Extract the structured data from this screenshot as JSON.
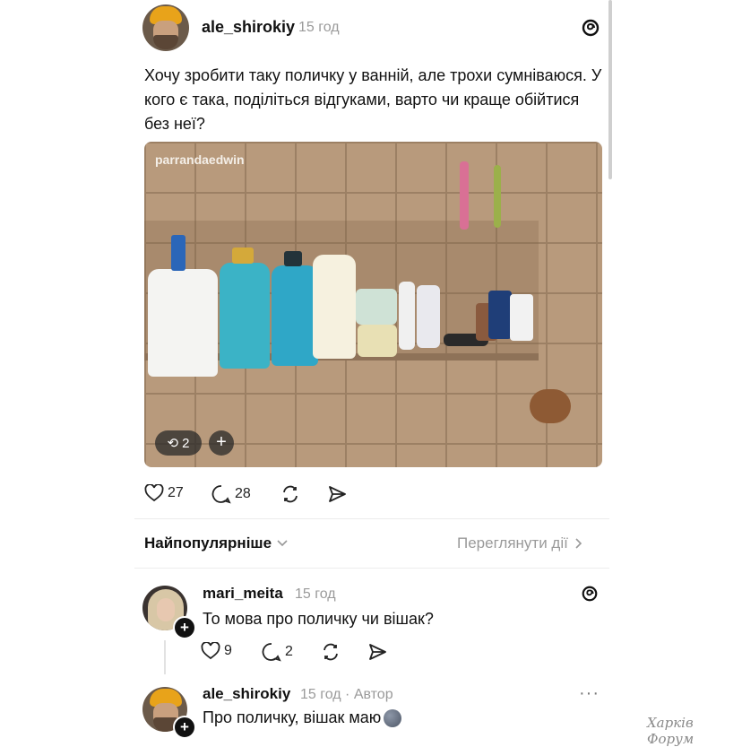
{
  "post": {
    "username": "ale_shirokiy",
    "time": "15 год",
    "text": "Хочу зробити таку поличку у ванній, але трохи сумніваюся. У кого є така, поділіться відгуками, варто чи краще обійтися без неї?",
    "image_watermark": "parrandaedwin",
    "image_badge_count": "2",
    "image_badge_plus": "+",
    "likes": "27",
    "comments": "28"
  },
  "sort": {
    "label": "Найпопулярніше",
    "activity_link": "Переглянути дії"
  },
  "replies": [
    {
      "username": "mari_meita",
      "time": "15 год",
      "text": "То мова про поличку чи вішак?",
      "likes": "9",
      "comments": "2"
    },
    {
      "username": "ale_shirokiy",
      "time": "15 год · Автор",
      "text": "Про поличку, вішак маю"
    }
  ],
  "watermark": "Харків Форум",
  "icons": [
    "threads-logo-icon",
    "heart-icon",
    "comment-icon",
    "repost-icon",
    "share-icon",
    "chevron-down-icon",
    "chevron-right-icon",
    "more-icon",
    "moon-emoji-icon"
  ]
}
